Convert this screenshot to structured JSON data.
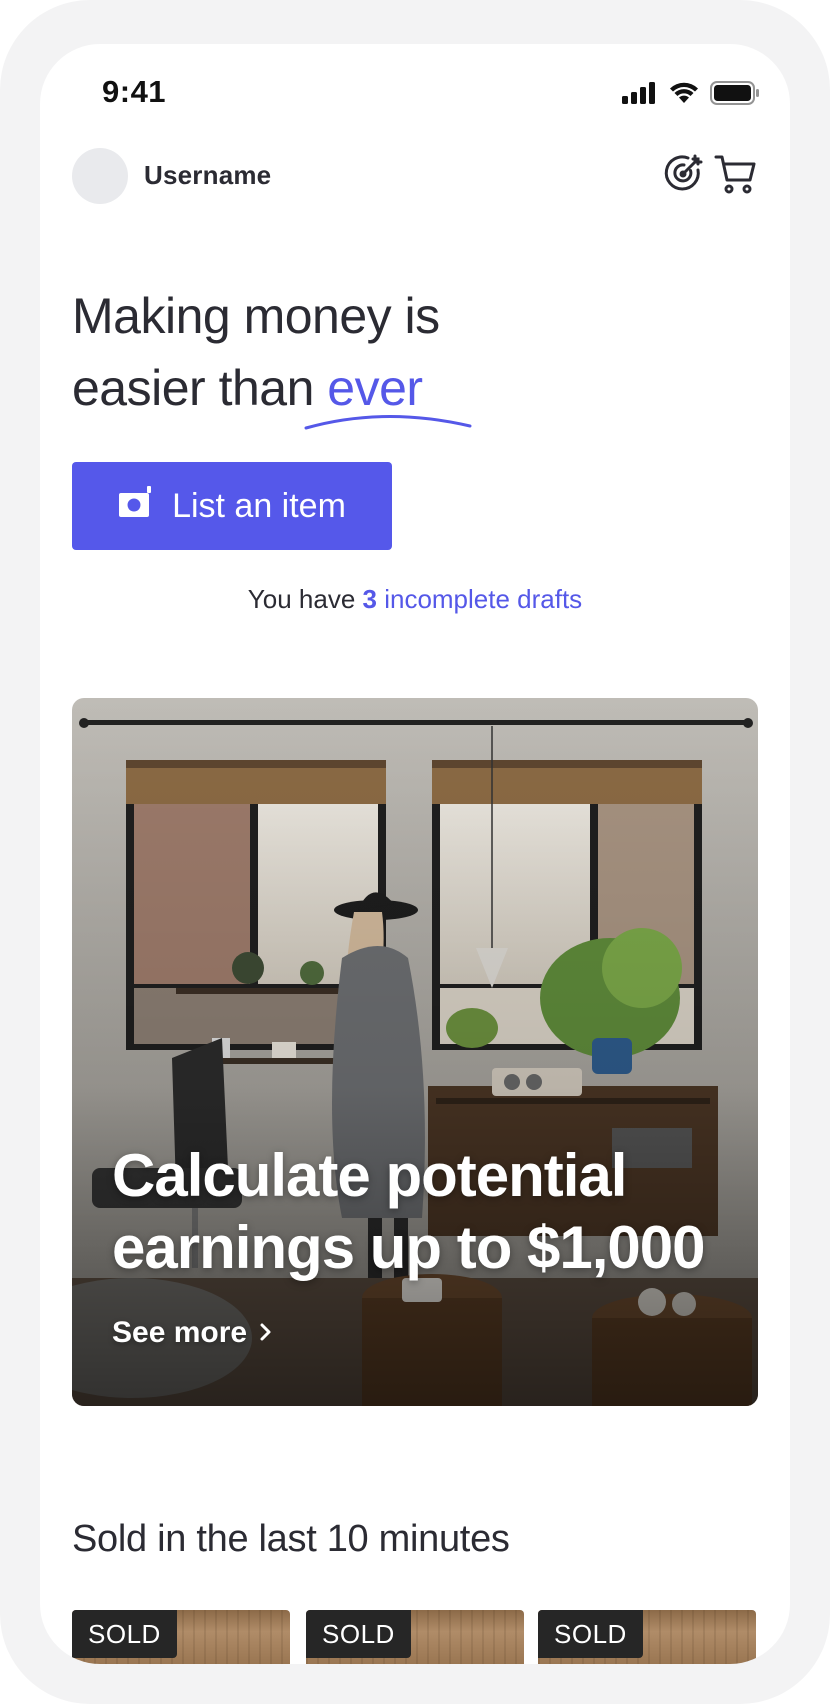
{
  "status_bar": {
    "time": "9:41"
  },
  "header": {
    "username": "Username",
    "icons": [
      "target-icon",
      "cart-icon"
    ]
  },
  "hero": {
    "title_line1": "Making money is",
    "title_line2_prefix": "easier than ",
    "title_accent": "ever",
    "list_button_label": "List an item"
  },
  "drafts": {
    "prefix": "You have ",
    "count": "3",
    "link_text": "incomplete drafts"
  },
  "promo": {
    "title": "Calculate potential earnings up to $1,000",
    "cta": "See more"
  },
  "sold_section": {
    "title": "Sold in the last 10 minutes",
    "items": [
      {
        "badge": "SOLD"
      },
      {
        "badge": "SOLD"
      },
      {
        "badge": "SOLD"
      }
    ]
  },
  "colors": {
    "accent": "#5558e8",
    "text": "#2b2b33",
    "badge_bg": "#262626"
  }
}
